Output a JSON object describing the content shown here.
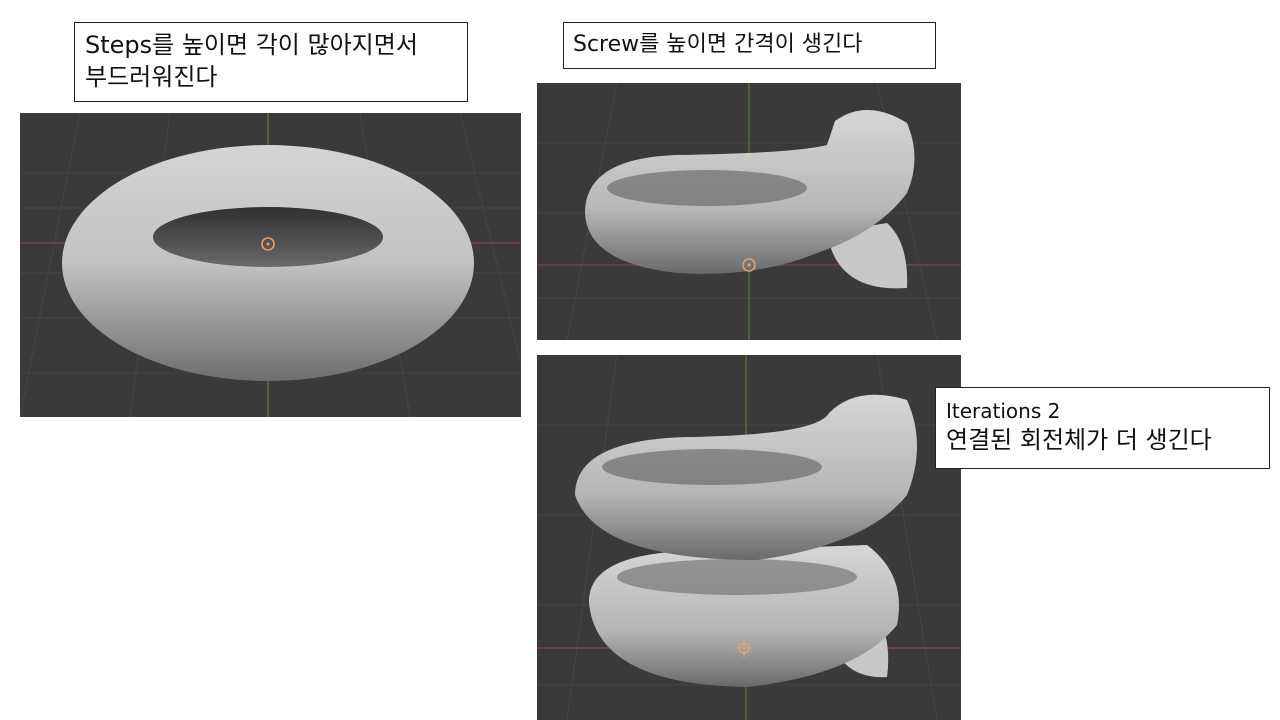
{
  "captions": {
    "steps": {
      "line1": "Steps를 높이면 각이 많아지면서",
      "line2": "부드러워진다"
    },
    "screw": {
      "line1": "Screw를 높이면 간격이 생긴다"
    },
    "iterations": {
      "line1": "Iterations 2",
      "line2": "연결된 회전체가 더 생긴다"
    }
  },
  "colors": {
    "viewport_bg": "#3a3a3a",
    "grid": "#4a4a4a",
    "axis_x": "#b04a5a",
    "axis_y": "#6a9a3a",
    "mesh_light": "#d8d8d8",
    "mesh_shadow": "#6e6e6e",
    "origin_marker": "#e8a070"
  },
  "viewports": [
    {
      "name": "torus",
      "object": "torus-mesh"
    },
    {
      "name": "screw",
      "object": "screw-mesh"
    },
    {
      "name": "iterations",
      "object": "helix-mesh"
    }
  ]
}
